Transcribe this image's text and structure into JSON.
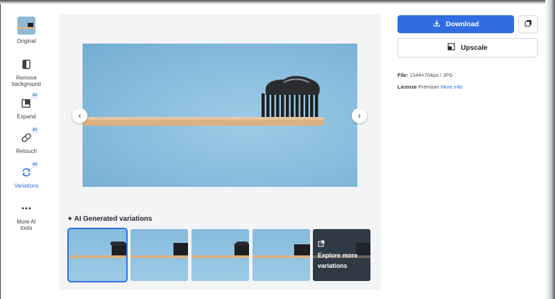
{
  "sidebar": {
    "items": [
      {
        "label": "Original",
        "icon": "original-thumbnail"
      },
      {
        "label": "Remove background",
        "icon": "remove-background-icon"
      },
      {
        "label": "Expand",
        "icon": "expand-icon",
        "badge": "AI"
      },
      {
        "label": "Retouch",
        "icon": "retouch-icon",
        "badge": "AI"
      },
      {
        "label": "Variations",
        "icon": "variations-icon",
        "badge": "AI",
        "active": true
      },
      {
        "label": "More AI tools",
        "icon": "more-icon"
      }
    ]
  },
  "variations": {
    "title": "AI Generated variations",
    "explore_label": "Explore more variations"
  },
  "actions": {
    "download_label": "Download",
    "upscale_label": "Upscale"
  },
  "info": {
    "file_label": "File:",
    "file_value": "1344×704px / JPG",
    "license_label": "License",
    "license_value": "Premium",
    "more_info_label": "More info"
  },
  "colors": {
    "accent": "#2f6de1",
    "photo_background": "#86bcdd"
  }
}
